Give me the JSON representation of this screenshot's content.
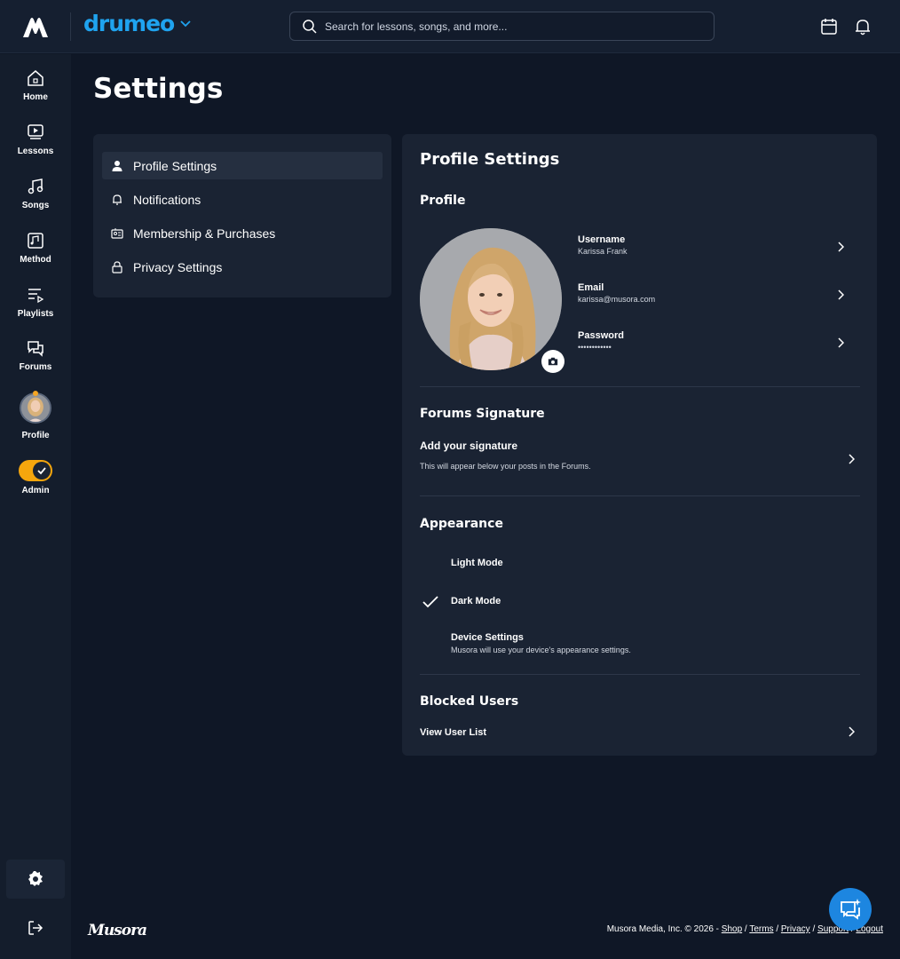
{
  "brand": {
    "name": "drumeo"
  },
  "search": {
    "placeholder": "Search for lessons, songs, and more..."
  },
  "sidebar": {
    "items": [
      {
        "label": "Home",
        "icon": "home-icon"
      },
      {
        "label": "Lessons",
        "icon": "play-icon"
      },
      {
        "label": "Songs",
        "icon": "music-note-icon"
      },
      {
        "label": "Method",
        "icon": "method-icon"
      },
      {
        "label": "Playlists",
        "icon": "playlist-icon"
      },
      {
        "label": "Forums",
        "icon": "chat-bubbles-icon"
      },
      {
        "label": "Profile",
        "icon": "avatar"
      },
      {
        "label": "Admin",
        "icon": "toggle"
      }
    ]
  },
  "page": {
    "title": "Settings"
  },
  "settings_nav": [
    {
      "label": "Profile Settings",
      "icon": "user-icon",
      "active": true
    },
    {
      "label": "Notifications",
      "icon": "bell-icon"
    },
    {
      "label": "Membership & Purchases",
      "icon": "id-card-icon"
    },
    {
      "label": "Privacy Settings",
      "icon": "lock-icon"
    }
  ],
  "panel": {
    "title": "Profile Settings",
    "profile": {
      "heading": "Profile",
      "username_label": "Username",
      "username_value": "Karissa Frank",
      "email_label": "Email",
      "email_value": "karissa@musora.com",
      "password_label": "Password",
      "password_value": "••••••••••••"
    },
    "signature": {
      "heading": "Forums Signature",
      "title": "Add your signature",
      "desc": "This will appear below your posts in the Forums."
    },
    "appearance": {
      "heading": "Appearance",
      "light": "Light Mode",
      "dark": "Dark Mode",
      "device": "Device Settings",
      "device_desc": "Musora will use your device's appearance settings.",
      "selected": "Dark Mode"
    },
    "blocked": {
      "heading": "Blocked Users",
      "view": "View User List"
    }
  },
  "footer": {
    "logo": "Musora",
    "copyright": "Musora Media, Inc. © 2026 - ",
    "links": [
      "Shop",
      "Terms",
      "Privacy",
      "Support",
      "Logout"
    ]
  },
  "colors": {
    "accent": "#1fa3ef",
    "toggle": "#f5a60d",
    "fab": "#1d86e0",
    "bg": "#0f1726",
    "card": "#1a2333"
  }
}
